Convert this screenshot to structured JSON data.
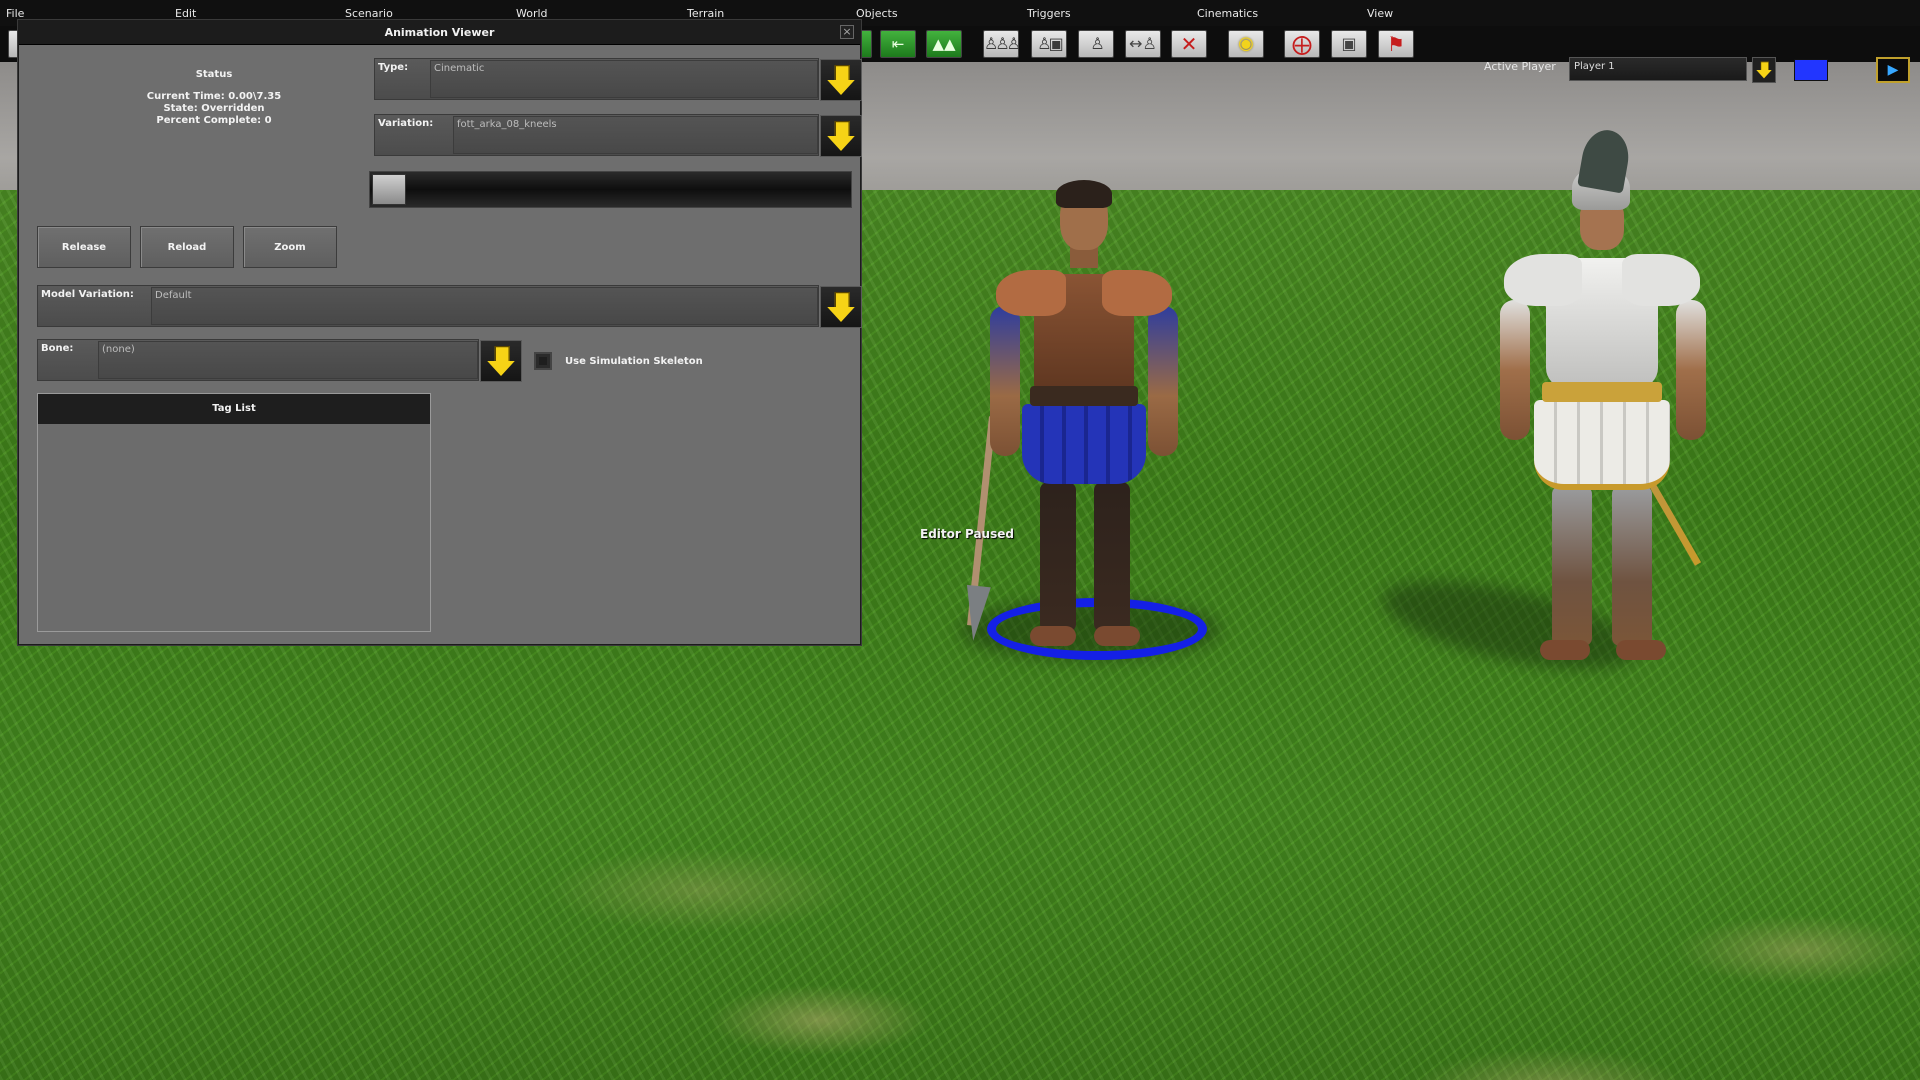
{
  "menubar": {
    "items": [
      "File",
      "Edit",
      "Scenario",
      "World",
      "Terrain",
      "Objects",
      "Triggers",
      "Cinematics",
      "View"
    ]
  },
  "toolbar": {
    "active_player_label": "Active Player",
    "active_player_value": "Player 1",
    "player_color": "#2236ff",
    "tools": [
      {
        "icon": "ui-sidebar-icon"
      },
      {
        "icon": "exit-arrow-icon"
      },
      {
        "icon": "trees-icon"
      },
      {
        "icon": "unit-group-icon"
      },
      {
        "icon": "unit-formation-icon"
      },
      {
        "icon": "single-unit-icon"
      },
      {
        "icon": "unit-move-icon"
      },
      {
        "icon": "unit-delete-icon"
      },
      {
        "icon": "lightbulb-icon"
      },
      {
        "icon": "crosshair-icon"
      },
      {
        "icon": "camera-icon"
      },
      {
        "icon": "unit-flag-icon"
      }
    ]
  },
  "window": {
    "title": "Animation Viewer",
    "status": {
      "title": "Status",
      "current_time": "Current Time: 0.00\\7.35",
      "state": "State: Overridden",
      "percent_complete": "Percent Complete: 0"
    },
    "type": {
      "label": "Type:",
      "value": "Cinematic"
    },
    "variation": {
      "label": "Variation:",
      "value": "fott_arka_08_kneels"
    },
    "progress": 0,
    "buttons": {
      "release": "Release",
      "reload": "Reload",
      "zoom": "Zoom"
    },
    "model_variation": {
      "label": "Model Variation:",
      "value": "Default"
    },
    "bone": {
      "label": "Bone:",
      "value": "(none)"
    },
    "use_sim_skeleton": {
      "label": "Use Simulation Skeleton",
      "checked": false
    },
    "tag_list": {
      "title": "Tag List",
      "items": []
    }
  },
  "scene": {
    "status_label": "Editor Paused",
    "selection_color": "#1420e6"
  }
}
